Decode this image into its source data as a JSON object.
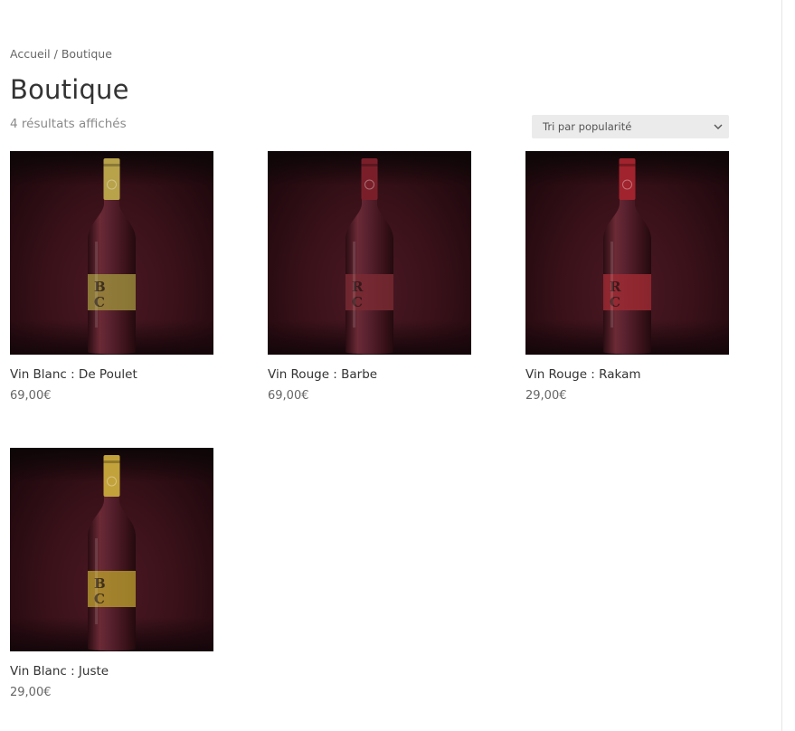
{
  "breadcrumb": {
    "home": "Accueil",
    "separator": " / ",
    "current": "Boutique"
  },
  "page_title": "Boutique",
  "result_count": "4 résultats affichés",
  "sort": {
    "selected": "Tri par popularité",
    "icon": "chevron-down-icon"
  },
  "products": [
    {
      "name": "Vin Blanc : De Poulet",
      "price": "69,00€",
      "capsule_color": "#b8a24a",
      "label_color": "#9a8a3c",
      "label_letters": "BC"
    },
    {
      "name": "Vin Rouge : Barbe",
      "price": "69,00€",
      "capsule_color": "#7a1f2a",
      "label_color": "#7a2a33",
      "label_letters": "RC"
    },
    {
      "name": "Vin Rouge : Rakam",
      "price": "29,00€",
      "capsule_color": "#a0232d",
      "label_color": "#9c2a32",
      "label_letters": "RC"
    },
    {
      "name": "Vin Blanc : Juste",
      "price": "29,00€",
      "capsule_color": "#c2a23a",
      "label_color": "#b0932e",
      "label_letters": "BC"
    }
  ]
}
